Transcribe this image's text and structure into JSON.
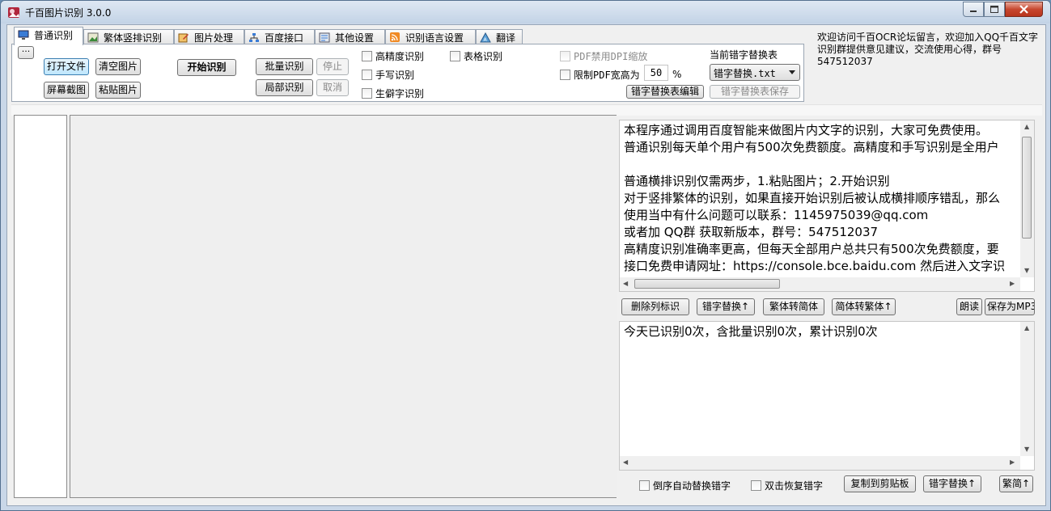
{
  "window": {
    "title": "千百图片识别 3.0.0"
  },
  "tabs": [
    {
      "label": "普通识别",
      "active": true
    },
    {
      "label": "繁体竖排识别"
    },
    {
      "label": "图片处理"
    },
    {
      "label": "百度接口"
    },
    {
      "label": "其他设置"
    },
    {
      "label": "识别语言设置"
    },
    {
      "label": "翻译"
    }
  ],
  "toolbar": {
    "more": "···",
    "open_file": "打开文件",
    "clear_image": "清空图片",
    "screenshot": "屏幕截图",
    "paste_image": "粘贴图片",
    "start_recognize": "开始识别",
    "batch_recognize": "批量识别",
    "stop": "停止",
    "partial_recognize": "局部识别",
    "cancel": "取消",
    "high_precision": "高精度识别",
    "table_recognize": "表格识别",
    "handwriting": "手写识别",
    "rare_chars": "生僻字识别",
    "pdf_disable_dpi": "PDF禁用DPI缩放",
    "limit_pdf_size": "限制PDF宽高为",
    "pdf_size_value": "50",
    "pdf_size_unit": "%",
    "replace_table_label": "当前错字替换表",
    "replace_table_selected": "错字替换.txt",
    "replace_table_edit": "错字替换表编辑",
    "replace_table_save": "错字替换表保存"
  },
  "notice": "欢迎访问千百OCR论坛留言，欢迎加入QQ千百文字识别群提供意见建议，交流使用心得，群号547512037",
  "output_text": [
    "本程序通过调用百度智能来做图片内文字的识别，大家可免费使用。",
    "普通识别每天单个用户有500次免费额度。高精度和手写识别是全用户",
    "",
    "普通横排识别仅需两步，1.粘贴图片；2.开始识别",
    "对于竖排繁体的识别，如果直接开始识别后被认成横排顺序错乱，那么",
    "使用当中有什么问题可以联系：1145975039@qq.com",
    "或者加 QQ群 获取新版本，群号：547512037",
    "高精度识别准确率更高，但每天全部用户总共只有500次免费额度，要",
    "接口免费申请网址：https://console.bce.baidu.com  然后进入文字识"
  ],
  "mid_buttons": {
    "remove_col_marks": "删除列标识",
    "replace_wrong": "错字替换↑",
    "trad_to_simp": "繁体转简体",
    "simp_to_trad": "简体转繁体↑",
    "read_aloud": "朗读",
    "save_mp3": "保存为MP3"
  },
  "stats_text": "今天已识别0次，含批量识别0次，累计识别0次",
  "bottom_bar": {
    "reverse_auto_replace": "倒序自动替换错字",
    "dblclick_restore": "双击恢复错字",
    "copy_clipboard": "复制到剪贴板",
    "replace_wrong": "错字替换↑",
    "trad_simp": "繁简↑"
  },
  "colors": {
    "accent": "#3c7fb1",
    "close": "#c7472f"
  }
}
